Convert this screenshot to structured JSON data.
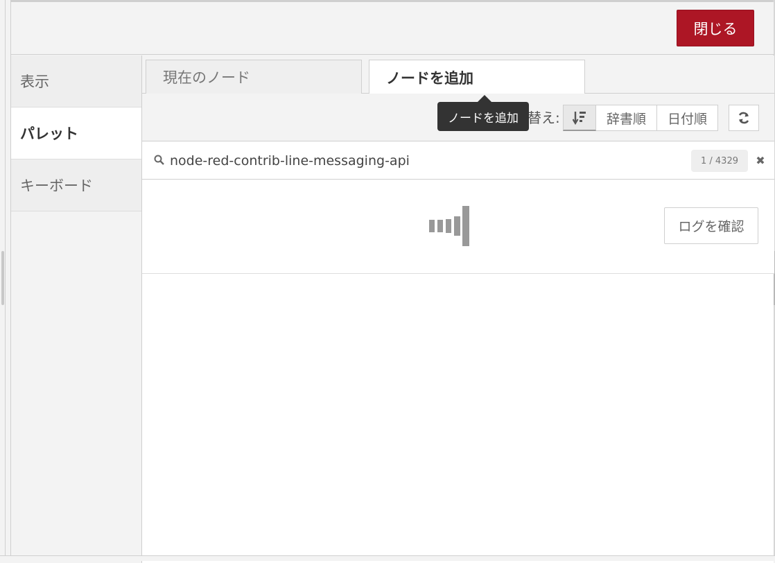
{
  "toolbar": {
    "close_label": "閉じる"
  },
  "sidebar": {
    "items": [
      {
        "label": "表示"
      },
      {
        "label": "パレット"
      },
      {
        "label": "キーボード"
      }
    ]
  },
  "tabs": [
    {
      "label": "現在のノード"
    },
    {
      "label": "ノードを追加"
    }
  ],
  "sort": {
    "label": "替え:",
    "alpha_label": "辞書順",
    "date_label": "日付順"
  },
  "tooltip": {
    "text": "ノードを追加"
  },
  "search": {
    "value": "node-red-contrib-line-messaging-api",
    "count": "1 / 4329"
  },
  "result": {
    "view_log_label": "ログを確認"
  },
  "icons": {
    "search": "search-icon",
    "sort": "sort-icon",
    "refresh": "refresh-icon",
    "close": "close-icon",
    "spinner": "loading-spinner-icon"
  },
  "colors": {
    "accent": "#ad1625"
  }
}
